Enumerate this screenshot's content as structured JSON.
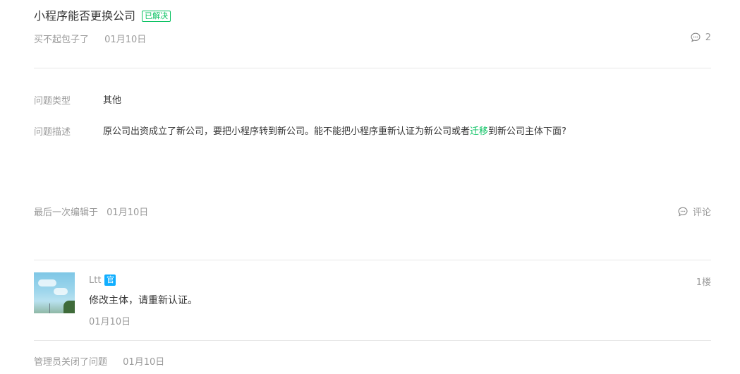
{
  "question": {
    "title": "小程序能否更换公司",
    "status_badge": "已解决",
    "author": "买不起包子了",
    "date": "01月10日",
    "comment_count": "2"
  },
  "fields": {
    "type_label": "问题类型",
    "type_value": "其他",
    "desc_label": "问题描述",
    "desc_before": "原公司出资成立了新公司，要把小程序转到新公司。能不能把小程序重新认证为新公司或者",
    "desc_link": "迁移",
    "desc_after": "到新公司主体下面?"
  },
  "footer": {
    "edited_label": "最后一次编辑于",
    "edited_date": "01月10日",
    "comment_label": "评论"
  },
  "reply": {
    "name": "Ltt",
    "official_badge": "官",
    "floor": "1楼",
    "text": "修改主体，请重新认证。",
    "date": "01月10日"
  },
  "closed": {
    "text": "管理员关闭了问题",
    "date": "01月10日"
  },
  "colors": {
    "accent": "#07c160",
    "official": "#10aeff",
    "muted": "#9a9a9a"
  },
  "icons": {
    "comment": "comment-bubble-icon"
  }
}
